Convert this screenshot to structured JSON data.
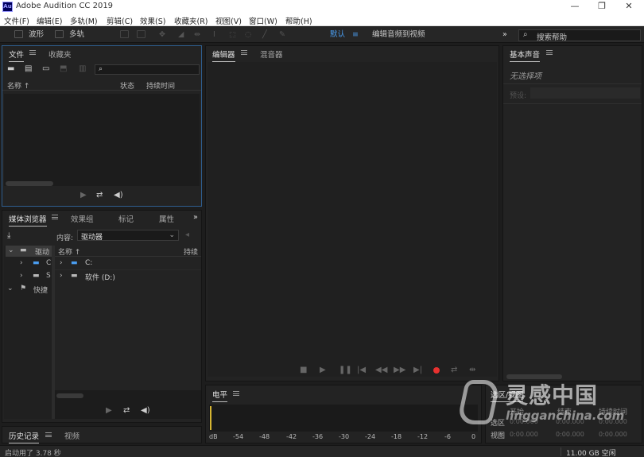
{
  "app": {
    "title": "Adobe Audition CC 2019",
    "logo": "Au"
  },
  "window_controls": [
    "—",
    "❐",
    "✕"
  ],
  "menu": [
    "文件(F)",
    "编辑(E)",
    "多轨(M)",
    "剪辑(C)",
    "效果(S)",
    "收藏夹(R)",
    "视图(V)",
    "窗口(W)",
    "帮助(H)"
  ],
  "toolbar": {
    "waveform_label": "波形",
    "multitrack_label": "多轨",
    "workspace_default": "默认",
    "workspace_edit_video": "编辑音频到视频",
    "search_placeholder": "搜索帮助"
  },
  "files_panel": {
    "tabs": [
      "文件",
      "收藏夹"
    ],
    "columns": {
      "name": "名称 ↑",
      "status": "状态",
      "duration": "持续时间"
    }
  },
  "media_panel": {
    "tabs": [
      "媒体浏览器",
      "效果组",
      "标记",
      "属性"
    ],
    "content_label": "内容:",
    "content_value": "驱动器",
    "columns": {
      "name": "名称 ↑",
      "duration": "持续"
    },
    "tree": [
      {
        "label": "驱动"
      },
      {
        "label": "C"
      },
      {
        "label": "S"
      },
      {
        "label": "快捷"
      }
    ],
    "drives": [
      {
        "label": "C:"
      },
      {
        "label": "软件 (D:)"
      }
    ]
  },
  "history_panel": {
    "tabs": [
      "历史记录",
      "视频"
    ]
  },
  "editor_panel": {
    "tabs": [
      "编辑器",
      "混音器"
    ]
  },
  "essential_sound": {
    "title": "基本声音",
    "no_selection": "无选择项",
    "preset_label": "预设:"
  },
  "level_panel": {
    "title": "电平",
    "scale": [
      "dB",
      "-54",
      "-48",
      "-42",
      "-36",
      "-30",
      "-24",
      "-18",
      "-12",
      "-6",
      "0"
    ]
  },
  "selection_view": {
    "title": "选区/视图",
    "headers": [
      "开始",
      "结束",
      "持续时间"
    ],
    "rows": [
      {
        "label": "选区",
        "values": [
          "0:00.000",
          "0:00.000",
          "0:00.000"
        ]
      },
      {
        "label": "视图",
        "values": [
          "0:00.000",
          "0:00.000",
          "0:00.000"
        ]
      }
    ]
  },
  "status_bar": {
    "left": "启动用了 3.78 秒",
    "right": "11.00 GB 空闲"
  },
  "watermark": {
    "text": "灵感中国",
    "url": "lingganchina.com"
  },
  "colors": {
    "accent_blue": "#4a9df0",
    "record_red": "#e8312f",
    "panel_border_active": "#2f5e8f"
  }
}
